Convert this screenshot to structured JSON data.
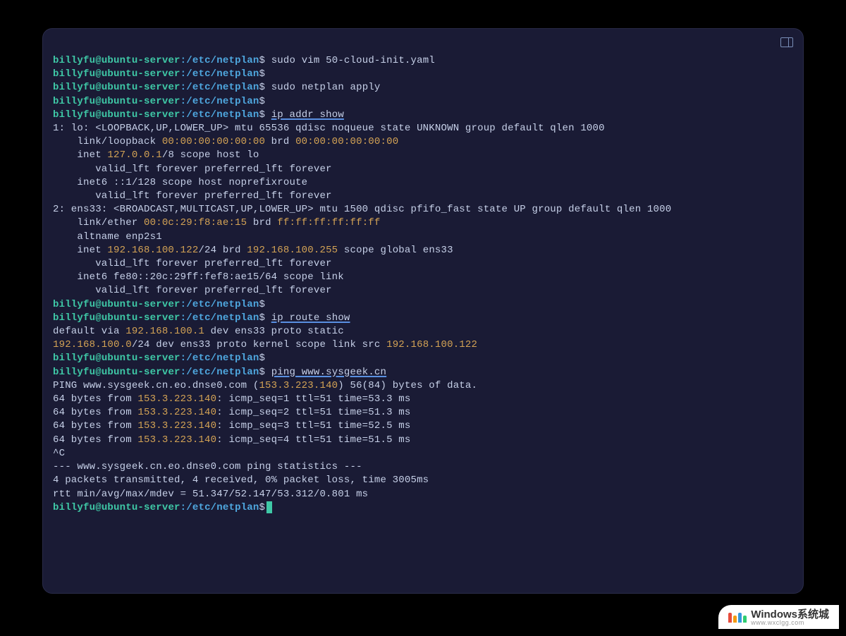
{
  "prompt": {
    "user": "billyfu",
    "at": "@",
    "host": "ubuntu-server",
    "colon": ":",
    "path": "/etc/netplan",
    "dollar": "$"
  },
  "commands": {
    "c1": "sudo vim 50-cloud-init.yaml",
    "c2": "sudo netplan apply",
    "c3": "ip addr show",
    "c4": "ip route show",
    "c5": "ping www.sysgeek.cn"
  },
  "ipaddr": {
    "lo_header": "1: lo: <LOOPBACK,UP,LOWER_UP> mtu 65536 qdisc noqueue state UNKNOWN group default qlen 1000",
    "lo_link_a": "    link/loopback ",
    "lo_mac1": "00:00:00:00:00:00",
    "lo_link_b": " brd ",
    "lo_mac2": "00:00:00:00:00:00",
    "lo_inet_a": "    inet ",
    "lo_ip": "127.0.0.1",
    "lo_inet_b": "/8 scope host lo",
    "valid": "       valid_lft forever preferred_lft forever",
    "lo_inet6": "    inet6 ::1/128 scope host noprefixroute",
    "ens_header": "2: ens33: <BROADCAST,MULTICAST,UP,LOWER_UP> mtu 1500 qdisc pfifo_fast state UP group default qlen 1000",
    "ens_link_a": "    link/ether ",
    "ens_mac1": "00:0c:29:f8:ae:15",
    "ens_link_b": " brd ",
    "ens_mac2": "ff:ff:ff:ff:ff:ff",
    "ens_alt": "    altname enp2s1",
    "ens_inet_a": "    inet ",
    "ens_ip": "192.168.100.122",
    "ens_inet_b": "/24 brd ",
    "ens_brd": "192.168.100.255",
    "ens_inet_c": " scope global ens33",
    "ens_inet6": "    inet6 fe80::20c:29ff:fef8:ae15/64 scope link"
  },
  "route": {
    "r1_a": "default via ",
    "r1_ip": "192.168.100.1",
    "r1_b": " dev ens33 proto static",
    "r2_ip": "192.168.100.0",
    "r2_a": "/24 dev ens33 proto kernel scope link src ",
    "r2_src": "192.168.100.122"
  },
  "ping": {
    "hdr_a": "PING www.sysgeek.cn.eo.dnse0.com (",
    "hdr_ip": "153.3.223.140",
    "hdr_b": ") 56(84) bytes of data.",
    "l1_a": "64 bytes from ",
    "ip": "153.3.223.140",
    "l1_b": ": icmp_seq=1 ttl=51 time=53.3 ms",
    "l2_b": ": icmp_seq=2 ttl=51 time=51.3 ms",
    "l3_b": ": icmp_seq=3 ttl=51 time=52.5 ms",
    "l4_b": ": icmp_seq=4 ttl=51 time=51.5 ms",
    "ctrlc": "^C",
    "stats_hdr": "--- www.sysgeek.cn.eo.dnse0.com ping statistics ---",
    "stats_1": "4 packets transmitted, 4 received, 0% packet loss, time 3005ms",
    "stats_2": "rtt min/avg/max/mdev = 51.347/52.147/53.312/0.801 ms"
  },
  "watermark": {
    "title": "Windows系统城",
    "url": "www.wxclgg.com",
    "bars": [
      {
        "h": 14,
        "c": "#e74c3c"
      },
      {
        "h": 10,
        "c": "#f39c12"
      },
      {
        "h": 14,
        "c": "#3498db"
      },
      {
        "h": 10,
        "c": "#2ecc71"
      }
    ]
  }
}
